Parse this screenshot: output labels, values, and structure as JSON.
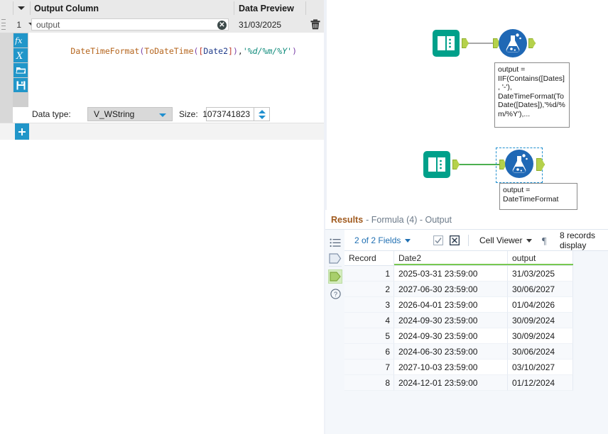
{
  "config": {
    "headers": {
      "output_column": "Output Column",
      "data_preview": "Data Preview"
    },
    "row": {
      "index": "1",
      "field_value": "output",
      "preview_value": "31/03/2025"
    },
    "formula": {
      "tokens": [
        {
          "t": "DateTimeFormat",
          "c": "fn"
        },
        {
          "t": "(",
          "c": "paren"
        },
        {
          "t": "ToDateTime",
          "c": "fn"
        },
        {
          "t": "(",
          "c": "paren"
        },
        {
          "t": "[",
          "c": "brk"
        },
        {
          "t": "Date2",
          "c": "field"
        },
        {
          "t": "]",
          "c": "brk"
        },
        {
          "t": ")",
          "c": "paren"
        },
        {
          "t": ",",
          "c": "punc"
        },
        {
          "t": "'%d/%m/%Y'",
          "c": "str"
        },
        {
          "t": ")",
          "c": "paren"
        }
      ],
      "plain": "DateTimeFormat(ToDateTime([Date2]),'%d/%m/%Y')"
    },
    "rail_icons": [
      "fx-icon",
      "variable-x-icon",
      "open-folder-icon",
      "save-disk-icon"
    ],
    "datatype": {
      "label": "Data type:",
      "value": "V_WString"
    },
    "size": {
      "label": "Size:",
      "value": "1073741823"
    },
    "add_row_label": "+"
  },
  "canvas": {
    "branch1": {
      "input_tool": "text-input-tool",
      "formula_tool": "formula-tool",
      "annotation": "output = IIF(Contains([Dates], '-'), DateTimeFormat(ToDate([Dates]),'%d/%m/%Y'),..."
    },
    "branch2": {
      "input_tool": "text-input-tool",
      "formula_tool": "formula-tool",
      "annotation": "output = DateTimeFormat",
      "selected": true
    }
  },
  "results": {
    "title_label": "Results",
    "title_sub": "- Formula (4) - Output",
    "rail_icons": [
      "list-view-icon",
      "input-anchor-icon",
      "output-anchor-icon",
      "help-icon"
    ],
    "toolbar": {
      "fields_label": "2 of 2 Fields",
      "select_all_icon": "checkbox-checked-icon",
      "deselect_icon": "checkbox-x-icon",
      "cell_viewer_label": "Cell Viewer",
      "pilcrow_icon": "pilcrow-icon",
      "records_label": "8 records display"
    },
    "table": {
      "columns": [
        "Record",
        "Date2",
        "output"
      ],
      "rows": [
        [
          "1",
          "2025-03-31 23:59:00",
          "31/03/2025"
        ],
        [
          "2",
          "2027-06-30 23:59:00",
          "30/06/2027"
        ],
        [
          "3",
          "2026-04-01 23:59:00",
          "01/04/2026"
        ],
        [
          "4",
          "2024-09-30 23:59:00",
          "30/09/2024"
        ],
        [
          "5",
          "2024-09-30 23:59:00",
          "30/09/2024"
        ],
        [
          "6",
          "2024-06-30 23:59:00",
          "30/06/2024"
        ],
        [
          "7",
          "2027-10-03 23:59:00",
          "03/10/2027"
        ],
        [
          "8",
          "2024-12-01 23:59:00",
          "01/12/2024"
        ]
      ]
    }
  },
  "colors": {
    "accent_blue": "#2196c9",
    "teal_tool": "#00a08a",
    "formula_blue": "#1f68b5",
    "anchor_green": "#b5d14b",
    "underline_green": "#78c850",
    "link_blue": "#1f6fb2",
    "results_title_orange": "#a05a1e"
  }
}
